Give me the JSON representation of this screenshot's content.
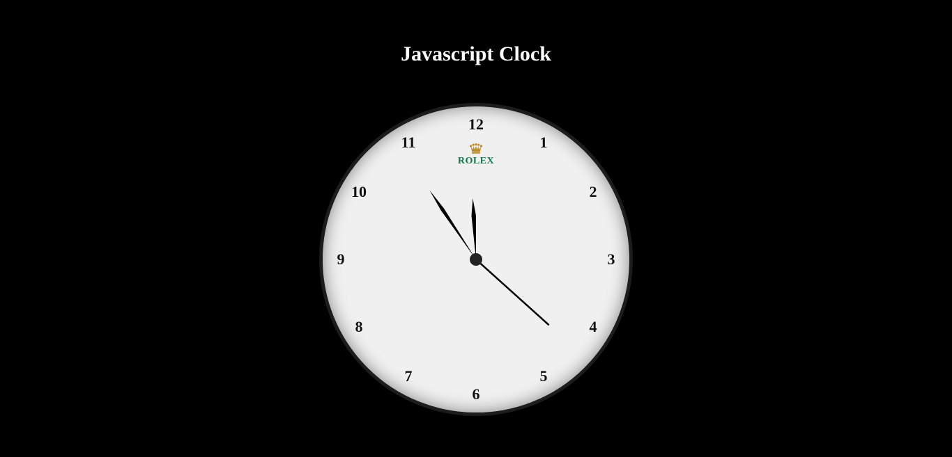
{
  "page": {
    "title": "Javascript Clock",
    "background_color": "#000000",
    "title_color": "#ffffff"
  },
  "clock": {
    "face_color": "#f0f0f0",
    "rim_color": "#1c1c1c",
    "brand": {
      "name": "ROLEX",
      "name_color": "#127749",
      "crown_color": "#c08a2a",
      "icon": "crown-icon"
    },
    "numerals": [
      "12",
      "1",
      "2",
      "3",
      "4",
      "5",
      "6",
      "7",
      "8",
      "9",
      "10",
      "11"
    ],
    "time": {
      "hours": 11,
      "minutes": 54,
      "seconds": 22
    },
    "hand_color": "#000000",
    "center_pin_color": "#222222"
  }
}
